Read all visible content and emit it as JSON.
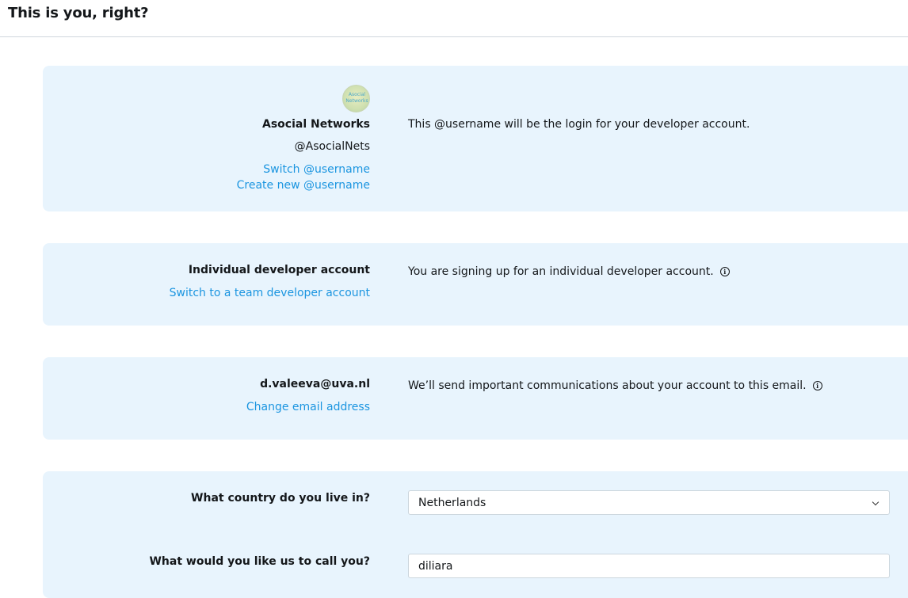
{
  "header": {
    "title": "This is you, right?"
  },
  "account": {
    "avatar_text": "Asocial Networks",
    "display_name": "Asocial Networks",
    "username": "@AsocialNets",
    "switch_username_link": "Switch @username",
    "create_username_link": "Create new @username",
    "description": "This @username will be the login for your developer account."
  },
  "account_type": {
    "label": "Individual developer account",
    "switch_link": "Switch to a team developer account",
    "description": "You are signing up for an individual developer account.",
    "info_icon": "info-icon"
  },
  "email": {
    "address": "d.valeeva@uva.nl",
    "change_link": "Change email address",
    "description": "We’ll send important communications about your account to this email.",
    "info_icon": "info-icon"
  },
  "form": {
    "country_label": "What country do you live in?",
    "country_value": "Netherlands",
    "name_label": "What would you like us to call you?",
    "name_value": "diliara"
  },
  "colors": {
    "card_background": "#e8f4fd",
    "link": "#1b95e0",
    "text": "#14171a",
    "divider": "#cfd6dc"
  }
}
